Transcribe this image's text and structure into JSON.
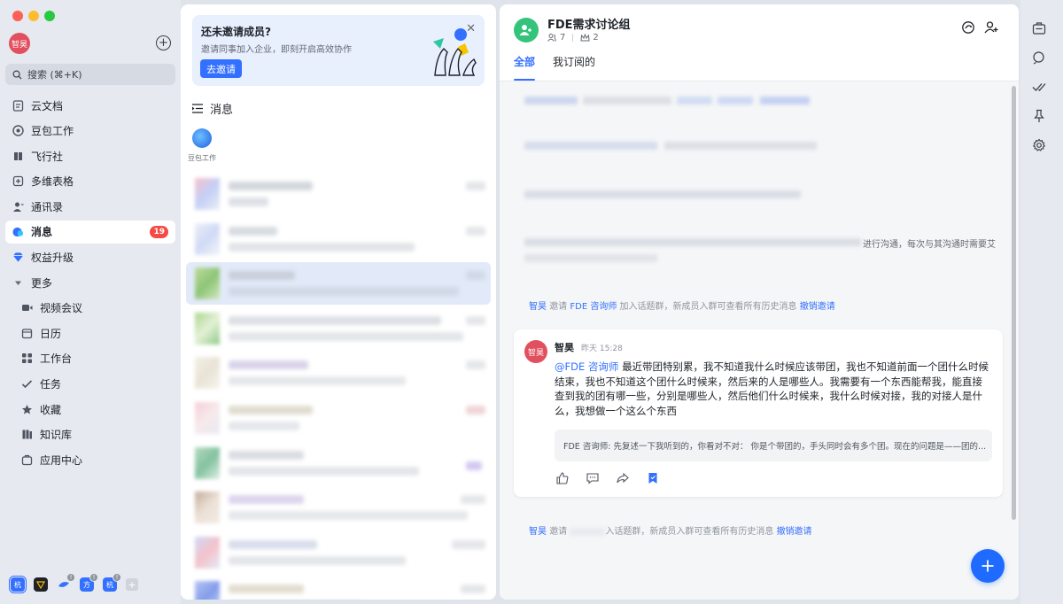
{
  "sidebar": {
    "user_avatar": "智昊",
    "search_placeholder": "搜索 (⌘+K)",
    "items": [
      {
        "label": "云文档",
        "icon": "doc-icon"
      },
      {
        "label": "豆包工作",
        "icon": "doubao-icon"
      },
      {
        "label": "飞行社",
        "icon": "book-icon"
      },
      {
        "label": "多维表格",
        "icon": "table-icon"
      },
      {
        "label": "通讯录",
        "icon": "contacts-icon"
      },
      {
        "label": "消息",
        "icon": "message-icon",
        "badge": "19",
        "active": true
      },
      {
        "label": "权益升级",
        "icon": "diamond-icon"
      },
      {
        "label": "更多",
        "icon": "caret-down-icon"
      },
      {
        "label": "视频会议",
        "icon": "video-icon"
      },
      {
        "label": "日历",
        "icon": "calendar-icon"
      },
      {
        "label": "工作台",
        "icon": "apps-icon"
      },
      {
        "label": "任务",
        "icon": "task-icon"
      },
      {
        "label": "收藏",
        "icon": "star-icon"
      },
      {
        "label": "知识库",
        "icon": "wiki-icon"
      },
      {
        "label": "应用中心",
        "icon": "app-center-icon"
      }
    ],
    "tenants": [
      {
        "label": "杭",
        "color": "#3370ff"
      },
      {
        "label": "",
        "color": "#1f2329"
      },
      {
        "label": "",
        "color": "#3370ff"
      },
      {
        "label": "方",
        "color": "#3370ff"
      },
      {
        "label": "杭",
        "color": "#3370ff"
      }
    ]
  },
  "message_panel": {
    "invite": {
      "title": "还未邀请成员?",
      "subtitle": "邀请同事加入企业，即刻开启高效协作",
      "button": "去邀请"
    },
    "section_title": "消息",
    "pinned_app": "豆包工作"
  },
  "chat": {
    "group_name": "FDE需求讨论组",
    "member_count": "7",
    "admin_count": "2",
    "tabs": [
      "全部",
      "我订阅的"
    ],
    "partial_text": "进行沟通，每次与其沟通时需要艾",
    "system_msg_1": {
      "actor": "智昊",
      "verb": "邀请",
      "target": "FDE 咨询师",
      "rest": "加入话题群，新成员入群可查看所有历史消息",
      "revoke": "撤销邀请"
    },
    "message": {
      "sender": "智昊",
      "time": "昨天 15:28",
      "mention": "@FDE 咨询师",
      "text": "最近带团特别累，我不知道我什么时候应该带团，我也不知道前面一个团什么时候结束，我也不知道这个团什么时候来，然后来的人是哪些人。我需要有一个东西能帮我，能直接查到我的团有哪一些，分别是哪些人，然后他们什么时候来，我什么时候对接，我的对接人是什么，我想做一个这么个东西",
      "quote": "FDE 咨询师: 先复述一下我听到的，你看对不对：  你是个带团的，手头同时会有多个团。现在的问题是——团的..."
    },
    "system_msg_2": {
      "actor": "智昊",
      "verb": "邀请",
      "rest": "入话题群，新成员入群可查看所有历史消息",
      "revoke": "撤销邀请"
    }
  }
}
